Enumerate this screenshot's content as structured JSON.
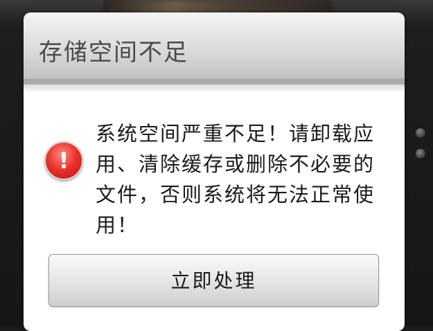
{
  "dialog": {
    "title": "存储空间不足",
    "message": "系统空间严重不足！请卸载应用、清除缓存或删除不必要的文件，否则系统将无法正常使用！",
    "icon": "warning-icon",
    "icon_glyph": "!",
    "action_label": "立即处理"
  },
  "colors": {
    "icon_red": "#e8312a",
    "title_text": "#4a4a4a"
  }
}
